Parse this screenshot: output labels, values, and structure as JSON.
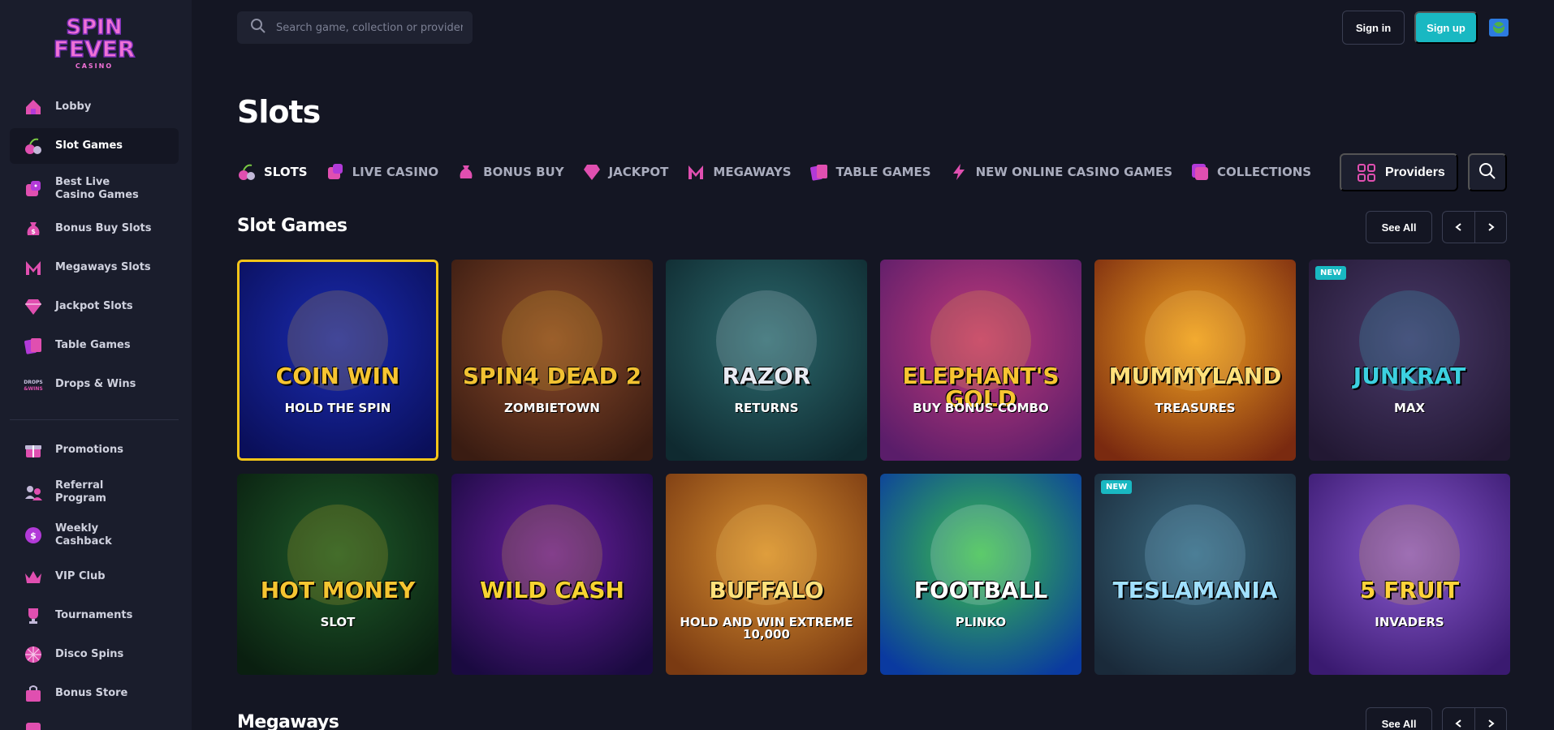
{
  "brand": {
    "name_line1": "SPIN",
    "name_line2": "FEVER",
    "subtitle": "CASINO"
  },
  "sidebar": {
    "items": [
      {
        "label": "Lobby",
        "icon": "home-icon"
      },
      {
        "label": "Slot Games",
        "icon": "cherry-icon",
        "active": true
      },
      {
        "label": "Best Live Casino Games",
        "icon": "dice-icon"
      },
      {
        "label": "Bonus Buy Slots",
        "icon": "money-bag-icon"
      },
      {
        "label": "Megaways Slots",
        "icon": "megaways-icon"
      },
      {
        "label": "Jackpot Slots",
        "icon": "diamond-icon"
      },
      {
        "label": "Table Games",
        "icon": "cards-icon"
      },
      {
        "label": "Drops & Wins",
        "icon": "drops-wins-icon"
      }
    ],
    "secondary": [
      {
        "label": "Promotions",
        "icon": "gift-icon"
      },
      {
        "label": "Referral Program",
        "icon": "referral-icon"
      },
      {
        "label": "Weekly Cashback",
        "icon": "cashback-icon"
      },
      {
        "label": "VIP Club",
        "icon": "crown-icon"
      },
      {
        "label": "Tournaments",
        "icon": "trophy-icon"
      },
      {
        "label": "Disco Spins",
        "icon": "disco-ball-icon"
      },
      {
        "label": "Bonus Store",
        "icon": "shopping-bag-icon"
      }
    ]
  },
  "header": {
    "search_placeholder": "Search game, collection or provider",
    "sign_in": "Sign in",
    "sign_up": "Sign up"
  },
  "main": {
    "title": "Slots",
    "tabs": [
      {
        "label": "SLOTS",
        "active": true
      },
      {
        "label": "LIVE CASINO"
      },
      {
        "label": "BONUS BUY"
      },
      {
        "label": "JACKPOT"
      },
      {
        "label": "MEGAWAYS"
      },
      {
        "label": "TABLE GAMES"
      },
      {
        "label": "NEW ONLINE CASINO GAMES"
      },
      {
        "label": "COLLECTIONS"
      }
    ],
    "providers_label": "Providers",
    "sections": [
      {
        "title": "Slot Games",
        "see_all": "See All"
      },
      {
        "title": "Megaways",
        "see_all": "See All"
      }
    ],
    "games": [
      {
        "title": "COIN WIN",
        "subtitle": "HOLD THE SPIN",
        "selected": true,
        "bg1": "#1a2bb0",
        "bg2": "#0a0f5a",
        "fg": "#f7c531"
      },
      {
        "title": "SPIN4 DEAD 2",
        "subtitle": "ZOMBIETOWN",
        "bg1": "#8a4a2a",
        "bg2": "#3a1c12",
        "fg": "#f1c232"
      },
      {
        "title": "RAZOR",
        "subtitle": "RETURNS",
        "bg1": "#2c6a6e",
        "bg2": "#0f2a30",
        "fg": "#e8eaf2"
      },
      {
        "title": "ELEPHANT'S GOLD",
        "subtitle": "BUY BONUS COMBO",
        "bg1": "#c23a7a",
        "bg2": "#5a1d6a",
        "fg": "#f7c531"
      },
      {
        "title": "MUMMYLAND",
        "subtitle": "TREASURES",
        "bg1": "#f0a020",
        "bg2": "#7a2a10",
        "fg": "#ffe07a"
      },
      {
        "title": "JUNKRAT",
        "subtitle": "MAX",
        "badge": "NEW",
        "bg1": "#4a3a6a",
        "bg2": "#221833",
        "fg": "#3cd0e0"
      },
      {
        "title": "HOT MONEY",
        "subtitle": "Slot",
        "bg1": "#1e5a2a",
        "bg2": "#0a1f10",
        "fg": "#f5c531"
      },
      {
        "title": "Wild CASH",
        "subtitle": "",
        "bg1": "#6a1fa0",
        "bg2": "#1a0a40",
        "fg": "#f7d331"
      },
      {
        "title": "BUFFALO",
        "subtitle": "HOLD AND WIN EXTREME 10,000",
        "bg1": "#d89030",
        "bg2": "#7a3a12",
        "fg": "#ffe07a"
      },
      {
        "title": "FOOTBALL",
        "subtitle": "PLINKO",
        "bg1": "#3ac04a",
        "bg2": "#0a3aa0",
        "fg": "#ffffff"
      },
      {
        "title": "TESLAMANIA",
        "subtitle": "",
        "badge": "NEW",
        "bg1": "#3a6a80",
        "bg2": "#1a2a3a",
        "fg": "#a0e0ff"
      },
      {
        "title": "5 FRUIT",
        "subtitle": "INVADERS",
        "bg1": "#8a5ad0",
        "bg2": "#3a1a70",
        "fg": "#ffd23a"
      }
    ]
  }
}
